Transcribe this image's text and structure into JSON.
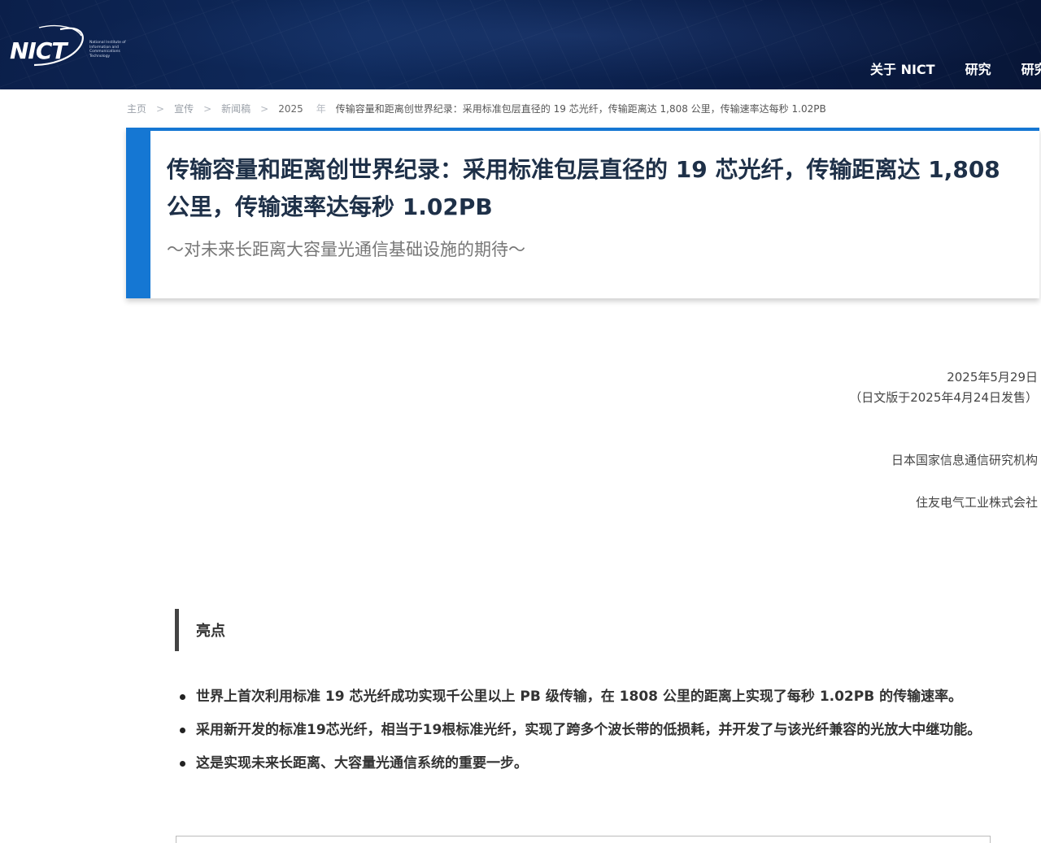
{
  "header": {
    "logo_text": "NICT",
    "logo_subtext": [
      "National Institute of",
      "Information and",
      "Communications",
      "Technology"
    ],
    "nav": [
      {
        "label": "关于 NICT"
      },
      {
        "label": "研究"
      },
      {
        "label": "研究"
      }
    ],
    "colors": {
      "bar": "#0f2a5c",
      "accent": "#1577d3"
    }
  },
  "breadcrumb": {
    "items": [
      "主页",
      "宣传",
      "新闻稿",
      "2025"
    ],
    "year_suffix": "年",
    "current": "传输容量和距离创世界纪录：采用标准包层直径的 19 芯光纤，传输距离达 1,808 公里，传输速率达每秒 1.02PB"
  },
  "article": {
    "title": "传输容量和距离创世界纪录：采用标准包层直径的 19 芯光纤，传输距离达 1,808 公里，传输速率达每秒 1.02PB",
    "subtitle": "～对未来长距离大容量光通信基础设施的期待～",
    "date": "2025年5月29日",
    "date_note": "（日文版于2025年4月24日发售）",
    "org1": "日本国家信息通信研究机构",
    "org2": "住友电气工业株式会社"
  },
  "highlights": {
    "heading": "亮点",
    "items": [
      "世界上首次利用标准 19 芯光纤成功实现千公里以上 PB 级传输，在 1808 公里的距离上实现了每秒 1.02PB 的传输速率。",
      "采用新开发的标准19芯光纤，相当于19根标准光纤，实现了跨多个波长带的低损耗，并开发了与该光纤兼容的光放大中继功能。",
      "这是实现未来长距离、大容量光通信系统的重要一步。"
    ]
  }
}
